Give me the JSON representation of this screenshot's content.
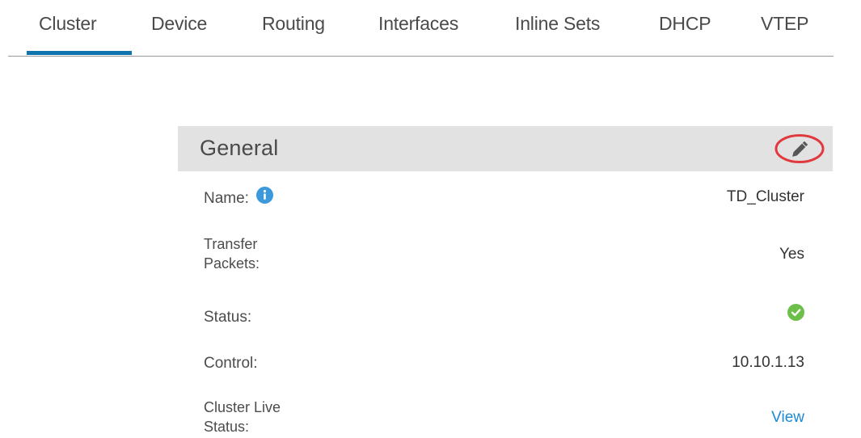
{
  "tabs": [
    {
      "label": "Cluster",
      "active": true
    },
    {
      "label": "Device"
    },
    {
      "label": "Routing"
    },
    {
      "label": "Interfaces"
    },
    {
      "label": "Inline Sets"
    },
    {
      "label": "DHCP"
    },
    {
      "label": "VTEP"
    }
  ],
  "general": {
    "title": "General",
    "edit_icon": "pencil-icon",
    "name_label": "Name:",
    "name_value": "TD_Cluster",
    "transfer_label_line1": "Transfer",
    "transfer_label_line2": "Packets:",
    "transfer_value": "Yes",
    "status_label": "Status:",
    "status_icon": "check-circle-icon",
    "control_label": "Control:",
    "control_value": "10.10.1.13",
    "live_label_line1": "Cluster Live",
    "live_label_line2": "Status:",
    "live_link": "View"
  },
  "colors": {
    "accent": "#0f73ad",
    "link": "#1c8ad1",
    "info": "#3b99dc",
    "success": "#6cc04a",
    "highlight_ring": "#e0393e",
    "header_bg": "#e2e2e2"
  }
}
